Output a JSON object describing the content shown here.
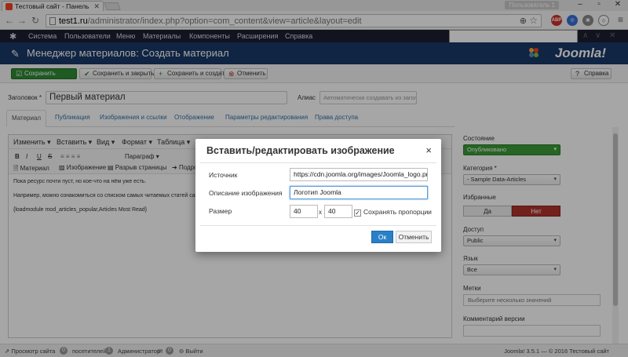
{
  "browser": {
    "tab_title": "Тестовый сайт - Панель",
    "user_button": "Пользователь 1",
    "url_domain": "test1.ru",
    "url_path": "/administrator/index.php?option=com_content&view=article&layout=edit",
    "icons": [
      "back-icon",
      "forward-icon",
      "reload-icon",
      "zoom-icon",
      "star-icon",
      "adblock-icon",
      "menu-icon"
    ]
  },
  "nav": {
    "items": [
      "Система",
      "Пользователи",
      "Меню",
      "Материалы",
      "Компоненты",
      "Расширения",
      "Справка"
    ]
  },
  "find_bar": {
    "prev": "∧",
    "next": "∨",
    "close": "✕"
  },
  "header": {
    "title": "Менеджер материалов: Создать материал",
    "brand": "Joomla!"
  },
  "toolbar": {
    "save": "Сохранить",
    "save_close": "Сохранить и закрыть",
    "save_new": "Сохранить и создать",
    "cancel": "Отменить",
    "help": "Справка"
  },
  "form": {
    "title_label": "Заголовок *",
    "title_value": "Первый материал",
    "alias_label": "Алиас",
    "alias_placeholder": "Автоматически создавать из загол"
  },
  "tabs": [
    "Материал",
    "Публикация",
    "Изображения и ссылки",
    "Отображение",
    "Параметры редактирования",
    "Права доступа"
  ],
  "editor": {
    "menu": [
      "Изменить ▾",
      "Вставить ▾",
      "Вид ▾",
      "Формат ▾",
      "Таблица ▾"
    ],
    "toolbar_row1": [
      "B",
      "I",
      "U",
      "S",
      "Параграф ▾"
    ],
    "toolbar_row2": [
      "Материал",
      "Изображение",
      "Разрыв страницы",
      "Подро"
    ],
    "content": [
      "Пока ресурс почти пуст, но кое-что на нём уже есть.",
      "Например, можно ознакомиться со списком самых читаемых статей сайта.",
      "{loadmodule mod_articles_popular,Articles Most Read}"
    ]
  },
  "sidebar": {
    "state_label": "Состояние",
    "state_value": "Опубликовано",
    "category_label": "Категория *",
    "category_value": "- Sample Data-Articles",
    "featured_label": "Избранные",
    "featured_yes": "Да",
    "featured_no": "Нет",
    "access_label": "Доступ",
    "access_value": "Public",
    "language_label": "Язык",
    "language_value": "Все",
    "tags_label": "Метки",
    "tags_placeholder": "Выберите несколько значений",
    "version_label": "Комментарий версии"
  },
  "status": {
    "view_site": "Просмотр сайта",
    "visitors_count": "0",
    "visitors": "посетителей",
    "admins_count": "1",
    "admins": "Администратор",
    "msg_count": "0",
    "logout": "Выйти",
    "version": "Joomla! 3.5.1 — © 2016 Тестовый сайт"
  },
  "modal": {
    "title": "Вставить/редактировать изображение",
    "source_label": "Источник",
    "source_value": "https://cdn.joomla.org/images/Joomla_logo.png",
    "desc_label": "Описание изображения",
    "desc_value": "Логотип Joomla",
    "size_label": "Размер",
    "width": "40",
    "x": "x",
    "height": "40",
    "keep_ratio": "Сохранять пропорции",
    "ok": "Ок",
    "cancel": "Отменить"
  },
  "colors": {
    "joomla_header": "#1a3867",
    "joomla_nav": "#1b1f2f",
    "save_green": "#2f8a34",
    "published_green": "#3b9b38",
    "no_red": "#b0342c",
    "ok_blue": "#2a80c8"
  }
}
